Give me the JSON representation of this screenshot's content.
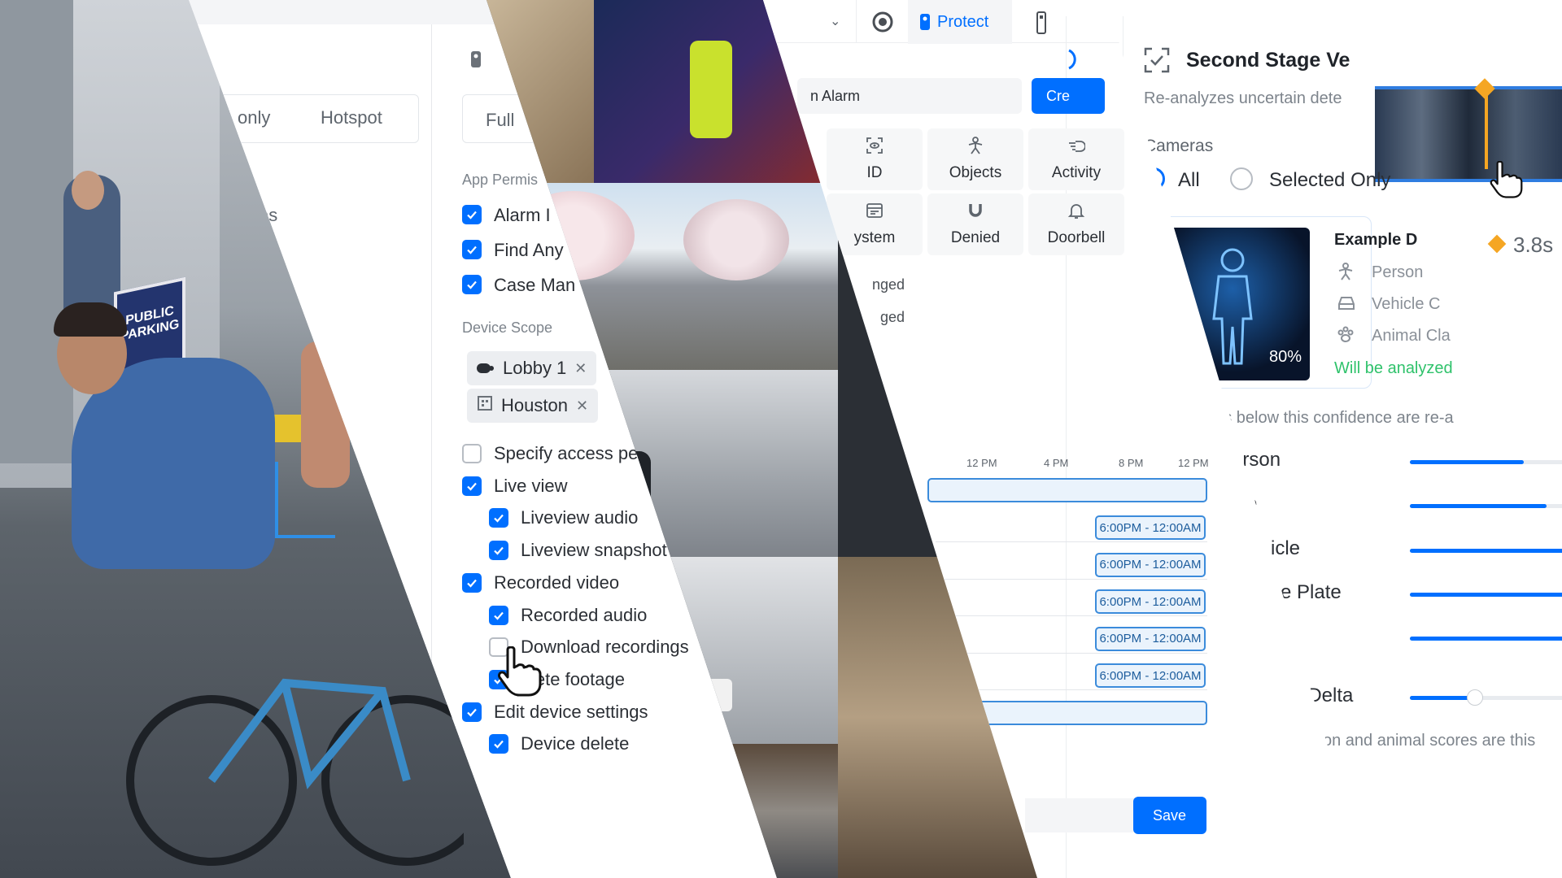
{
  "cyclist_panel": {
    "sign_text": "PUBLIC\nPARKING"
  },
  "settings_panel": {
    "mode_tabs": [
      "only",
      "Hotspot"
    ],
    "partial_label": "es",
    "access_select": "Full",
    "app_permissions_title": "App Permis",
    "app_permissions": [
      "Alarm I",
      "Find Any",
      "Case Man"
    ],
    "device_scope_title": "Device Scope",
    "device_scope_chips": [
      "Lobby 1",
      "Houston"
    ],
    "permissions": [
      {
        "label": "Specify access pe",
        "checked": false,
        "indent": false
      },
      {
        "label": "Live view",
        "checked": true,
        "indent": false
      },
      {
        "label": "Liveview audio",
        "checked": true,
        "indent": true
      },
      {
        "label": "Liveview snapshot",
        "checked": true,
        "indent": true
      },
      {
        "label": "Recorded video",
        "checked": true,
        "indent": false
      },
      {
        "label": "Recorded audio",
        "checked": true,
        "indent": true
      },
      {
        "label": "Download recordings",
        "checked": false,
        "indent": true
      },
      {
        "label": "lete footage",
        "checked": true,
        "indent": true
      },
      {
        "label": "Edit device settings",
        "checked": true,
        "indent": false
      },
      {
        "label": "Device delete",
        "checked": true,
        "indent": true
      }
    ]
  },
  "alarm_panel": {
    "top_tab": "Protect",
    "alarm_input": "n Alarm",
    "create_button": "Cre",
    "trigger_tiles": [
      {
        "label": "ID",
        "icon": "face-id-icon"
      },
      {
        "label": "Objects",
        "icon": "person-icon"
      },
      {
        "label": "Activity",
        "icon": "motion-icon"
      },
      {
        "label": "ystem",
        "icon": "system-icon"
      },
      {
        "label": "Denied",
        "icon": "magnet-icon"
      },
      {
        "label": "Doorbell",
        "icon": "bell-icon"
      }
    ],
    "status_lines": [
      "nged",
      "ged"
    ],
    "timeline_ticks": [
      "12 PM",
      "4 PM",
      "8 PM",
      "12 PM"
    ],
    "schedule_chips": [
      "6:00PM - 12:00AM",
      "6:00PM - 12:00AM",
      "6:00PM - 12:00AM",
      "6:00PM - 12:00AM",
      "6:00PM - 12:00AM"
    ],
    "save_button": "Save"
  },
  "second_stage_panel": {
    "title": "Second Stage Ve",
    "subtitle": "Re-analyzes uncertain dete",
    "cameras_label": "Cameras",
    "camera_options": [
      {
        "label": "All",
        "selected": true
      },
      {
        "label": "Selected Only",
        "selected": false
      }
    ],
    "example_title": "Example D",
    "example_confidence": "80%",
    "example_items": [
      {
        "label": "Person",
        "icon": "person-icon"
      },
      {
        "label": "Vehicle C",
        "icon": "car-icon"
      },
      {
        "label": "Animal Cla",
        "icon": "paw-icon"
      }
    ],
    "example_note": "Will be analyzed",
    "marker_time": "3.8s",
    "threshold_note": "ons below this confidence are re-a",
    "sliders": [
      {
        "label": "Person",
        "value": 0.35
      },
      {
        "label": "ce",
        "value": 0.42
      },
      {
        "label": "icle",
        "value": 0.49
      },
      {
        "label": "se Plate",
        "value": 0.55
      },
      {
        "label": "",
        "value": 0.6
      },
      {
        "label": "al Delta",
        "value": 0.2
      }
    ],
    "footer_note": "on and animal scores are this",
    "accent": "#006fff",
    "marker_color": "#f5a623",
    "note_color": "#2fc26b"
  }
}
